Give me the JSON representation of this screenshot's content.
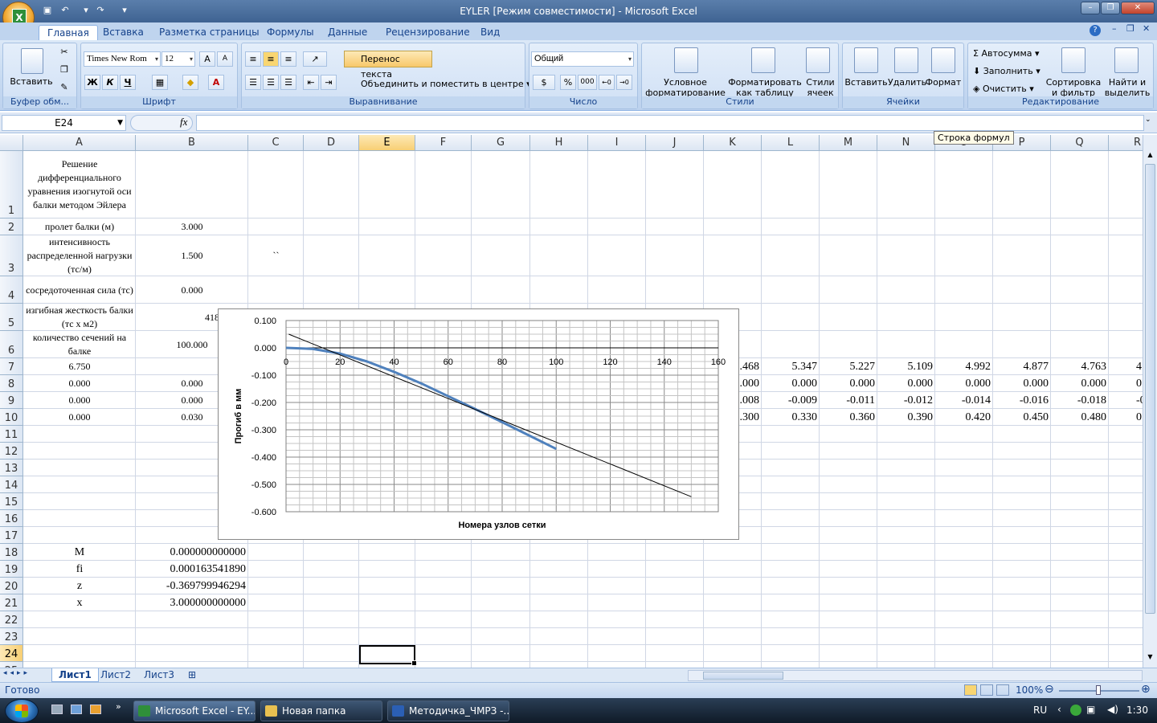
{
  "window": {
    "title": "EYLER  [Режим совместимости] - Microsoft Excel",
    "controls": {
      "minimize": "–",
      "maximize": "❐",
      "close": "✕"
    }
  },
  "ribbon_tabs": [
    "Главная",
    "Вставка",
    "Разметка страницы",
    "Формулы",
    "Данные",
    "Рецензирование",
    "Вид"
  ],
  "clipboard": {
    "paste": "Вставить",
    "label": "Буфер обм..."
  },
  "font": {
    "name": "Times New Rom",
    "size": "12",
    "bold": "Ж",
    "italic": "К",
    "underline": "Ч",
    "color_glyph": "A",
    "grow": "A",
    "shrink": "A",
    "label": "Шрифт"
  },
  "alignment": {
    "wrap": "Перенос текста",
    "merge": "Объединить и поместить в центре",
    "label": "Выравнивание"
  },
  "number": {
    "format": "Общий",
    "percent": "%",
    "thousands": "000",
    "label": "Число"
  },
  "styles": {
    "conditional": "Условное форматирование",
    "as_table": "Форматировать как таблицу",
    "cell_styles": "Стили ячеек",
    "label": "Стили"
  },
  "cells": {
    "insert": "Вставить",
    "delete": "Удалить",
    "format": "Формат",
    "label": "Ячейки"
  },
  "editing": {
    "autosum": "Автосумма",
    "fill": "Заполнить",
    "clear": "Очистить",
    "sort": "Сортировка и фильтр",
    "find": "Найти и выделить",
    "label": "Редактирование"
  },
  "formula_bar": {
    "name_box": "E24",
    "fx": "fx",
    "content": "",
    "tooltip": "Строка формул"
  },
  "columns": [
    "A",
    "B",
    "C",
    "D",
    "E",
    "F",
    "G",
    "H",
    "I",
    "J",
    "K",
    "L",
    "M",
    "N",
    "O",
    "P",
    "Q",
    "R"
  ],
  "selected_column": "E",
  "rows": [
    "1",
    "2",
    "3",
    "4",
    "5",
    "6",
    "7",
    "8",
    "9",
    "10",
    "11",
    "12",
    "13",
    "14",
    "15",
    "16",
    "17",
    "18",
    "19",
    "20",
    "21",
    "22",
    "23",
    "24",
    "25"
  ],
  "selected_row": "24",
  "cells_data": {
    "A1": "Решение дифференциального уравнения изогнутой оси балки методом Эйлера",
    "A2": "пролет балки (м)",
    "B2": "3.000",
    "A3": "интенсивность распределенной нагрузки (тс/м)",
    "B3": "1.500",
    "C3": "``",
    "A4": "сосредоточенная сила (тс)",
    "B4": "0.000",
    "A5": "изгибная жесткость балки (тс х  м2)",
    "B5": "41895.000",
    "A6": "количество сечений на балке",
    "B6": "100.000",
    "A7": "6.750",
    "A8": "0.000",
    "B8": "0.000",
    "A9": "0.000",
    "B9": "0.000",
    "A10": "0.000",
    "B10": "0.030",
    "A18": "M",
    "B18": "0.000000000000",
    "A19": "fi",
    "B19": "0.000163541890",
    "A20": "z",
    "B20": "-0.369799946294",
    "A21": "x",
    "B21": "3.000000000000"
  },
  "right_rows": {
    "r7": [
      ".468",
      "5.347",
      "5.227",
      "5.109",
      "4.992",
      "4.877",
      "4.763",
      "4"
    ],
    "r8": [
      ".000",
      "0.000",
      "0.000",
      "0.000",
      "0.000",
      "0.000",
      "0.000",
      "0"
    ],
    "r9": [
      ".008",
      "-0.009",
      "-0.011",
      "-0.012",
      "-0.014",
      "-0.016",
      "-0.018",
      "-0"
    ],
    "r10": [
      ".300",
      "0.330",
      "0.360",
      "0.390",
      "0.420",
      "0.450",
      "0.480",
      "0"
    ]
  },
  "chart_data": {
    "type": "line",
    "title": "",
    "xlabel": "Номера узлов сетки",
    "ylabel": "Прогиб в мм",
    "xlim": [
      0,
      160
    ],
    "ylim": [
      -0.6,
      0.1
    ],
    "x_ticks": [
      "0",
      "20",
      "40",
      "60",
      "80",
      "100",
      "120",
      "140",
      "160"
    ],
    "y_ticks": [
      "0.100",
      "0.000",
      "-0.100",
      "-0.200",
      "-0.300",
      "-0.400",
      "-0.500",
      "-0.600"
    ],
    "grid": true,
    "series": [
      {
        "color": "#4f81bd",
        "x": [
          0,
          10,
          20,
          30,
          40,
          50,
          60,
          70,
          80,
          90,
          100
        ],
        "y": [
          0.0,
          -0.004,
          -0.021,
          -0.05,
          -0.088,
          -0.13,
          -0.177,
          -0.224,
          -0.272,
          -0.321,
          -0.37
        ]
      },
      {
        "color": "#000000",
        "x": [
          1,
          150
        ],
        "y": [
          0.05,
          -0.545
        ]
      }
    ]
  },
  "sheets": [
    "Лист1",
    "Лист2",
    "Лист3"
  ],
  "active_sheet": "Лист1",
  "status": {
    "ready": "Готово",
    "zoom": "100%"
  },
  "taskbar": {
    "buttons": [
      "Microsoft Excel - EY...",
      "Новая папка",
      "Методичка_ЧМРЗ -..."
    ],
    "lang": "RU",
    "time": "1:30"
  }
}
